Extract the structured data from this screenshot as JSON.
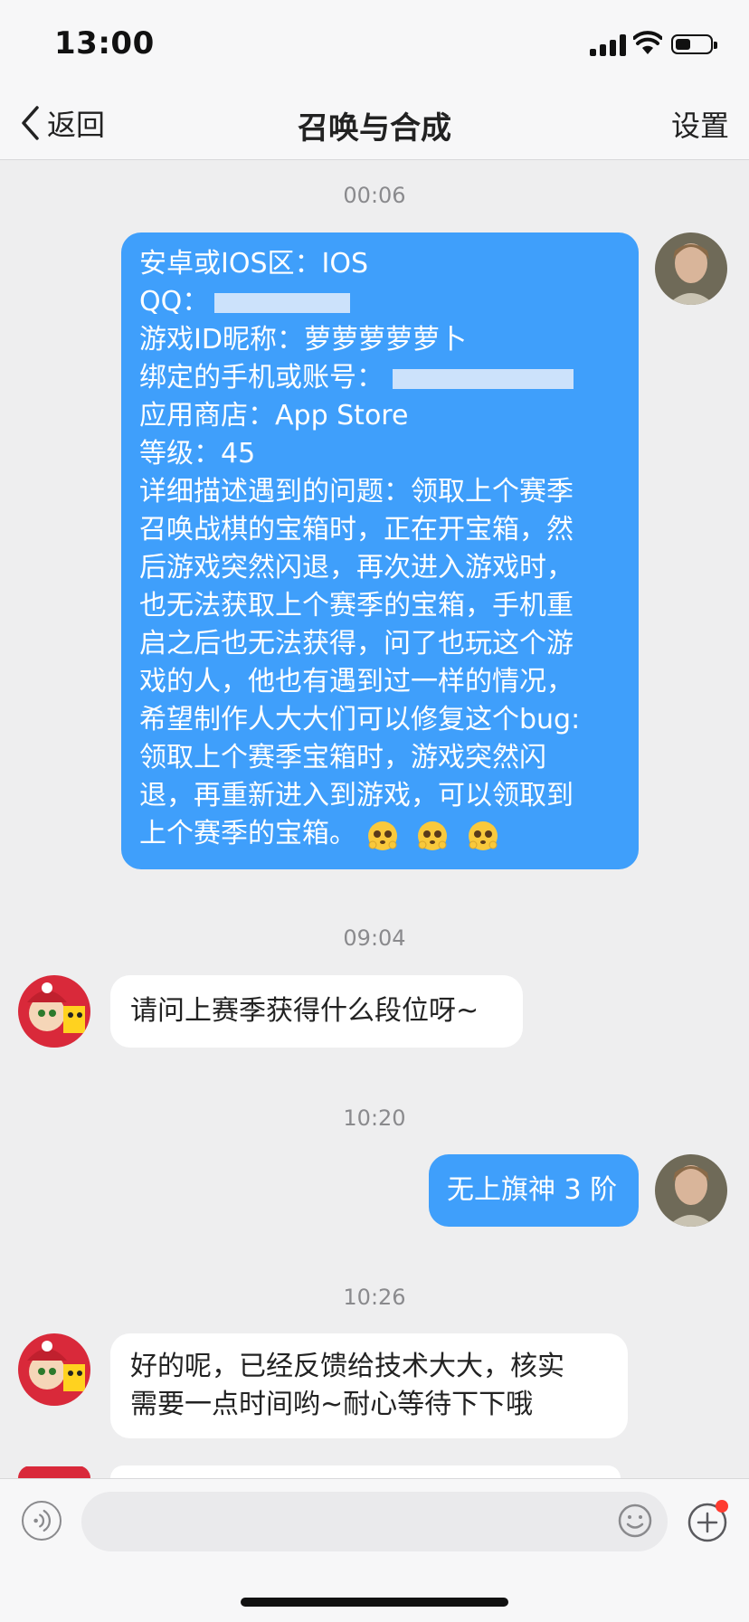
{
  "status_bar": {
    "time": "13:00"
  },
  "nav": {
    "back_label": "返回",
    "title": "召唤与合成",
    "settings_label": "设置"
  },
  "chat": {
    "timestamps": [
      "00:06",
      "09:04",
      "10:20",
      "10:26"
    ],
    "msg1": {
      "lines": [
        "安卓或IOS区：IOS",
        "QQ：",
        "游戏ID昵称：萝萝萝萝萝卜",
        "绑定的手机或账号：",
        "应用商店：App Store",
        "等级：45",
        "详细描述遇到的问题：领取上个赛季",
        "召唤战棋的宝箱时，正在开宝箱，然",
        "后游戏突然闪退，再次进入游戏时，",
        "也无法获取上个赛季的宝箱，手机重",
        "启之后也无法获得，问了也玩这个游",
        "戏的人，他也有遇到过一样的情况，",
        "希望制作人大大们可以修复这个bug:",
        "领取上个赛季宝箱时，游戏突然闪",
        "退，再重新进入到游戏，可以领取到",
        "上个赛季的宝箱。"
      ],
      "emoji": [
        "pleading-face-emoji",
        "pleading-face-emoji",
        "pleading-face-emoji"
      ]
    },
    "msg2": {
      "text": "请问上赛季获得什么段位呀~"
    },
    "msg3": {
      "text": "无上旗神 3 阶"
    },
    "msg4": {
      "lines": [
        "好的呢，已经反馈给技术大大，核实",
        "需要一点时间哟~耐心等待下下哦"
      ]
    }
  },
  "input_bar": {
    "placeholder": ""
  },
  "colors": {
    "outgoing_bubble": "#3f9ffb",
    "incoming_bubble": "#ffffff",
    "background": "#eeeeef",
    "badge": "#ff3b30"
  },
  "icons": [
    "signal-icon",
    "wifi-icon",
    "battery-icon",
    "back-chevron-icon",
    "voice-icon",
    "emoji-icon",
    "plus-icon"
  ]
}
